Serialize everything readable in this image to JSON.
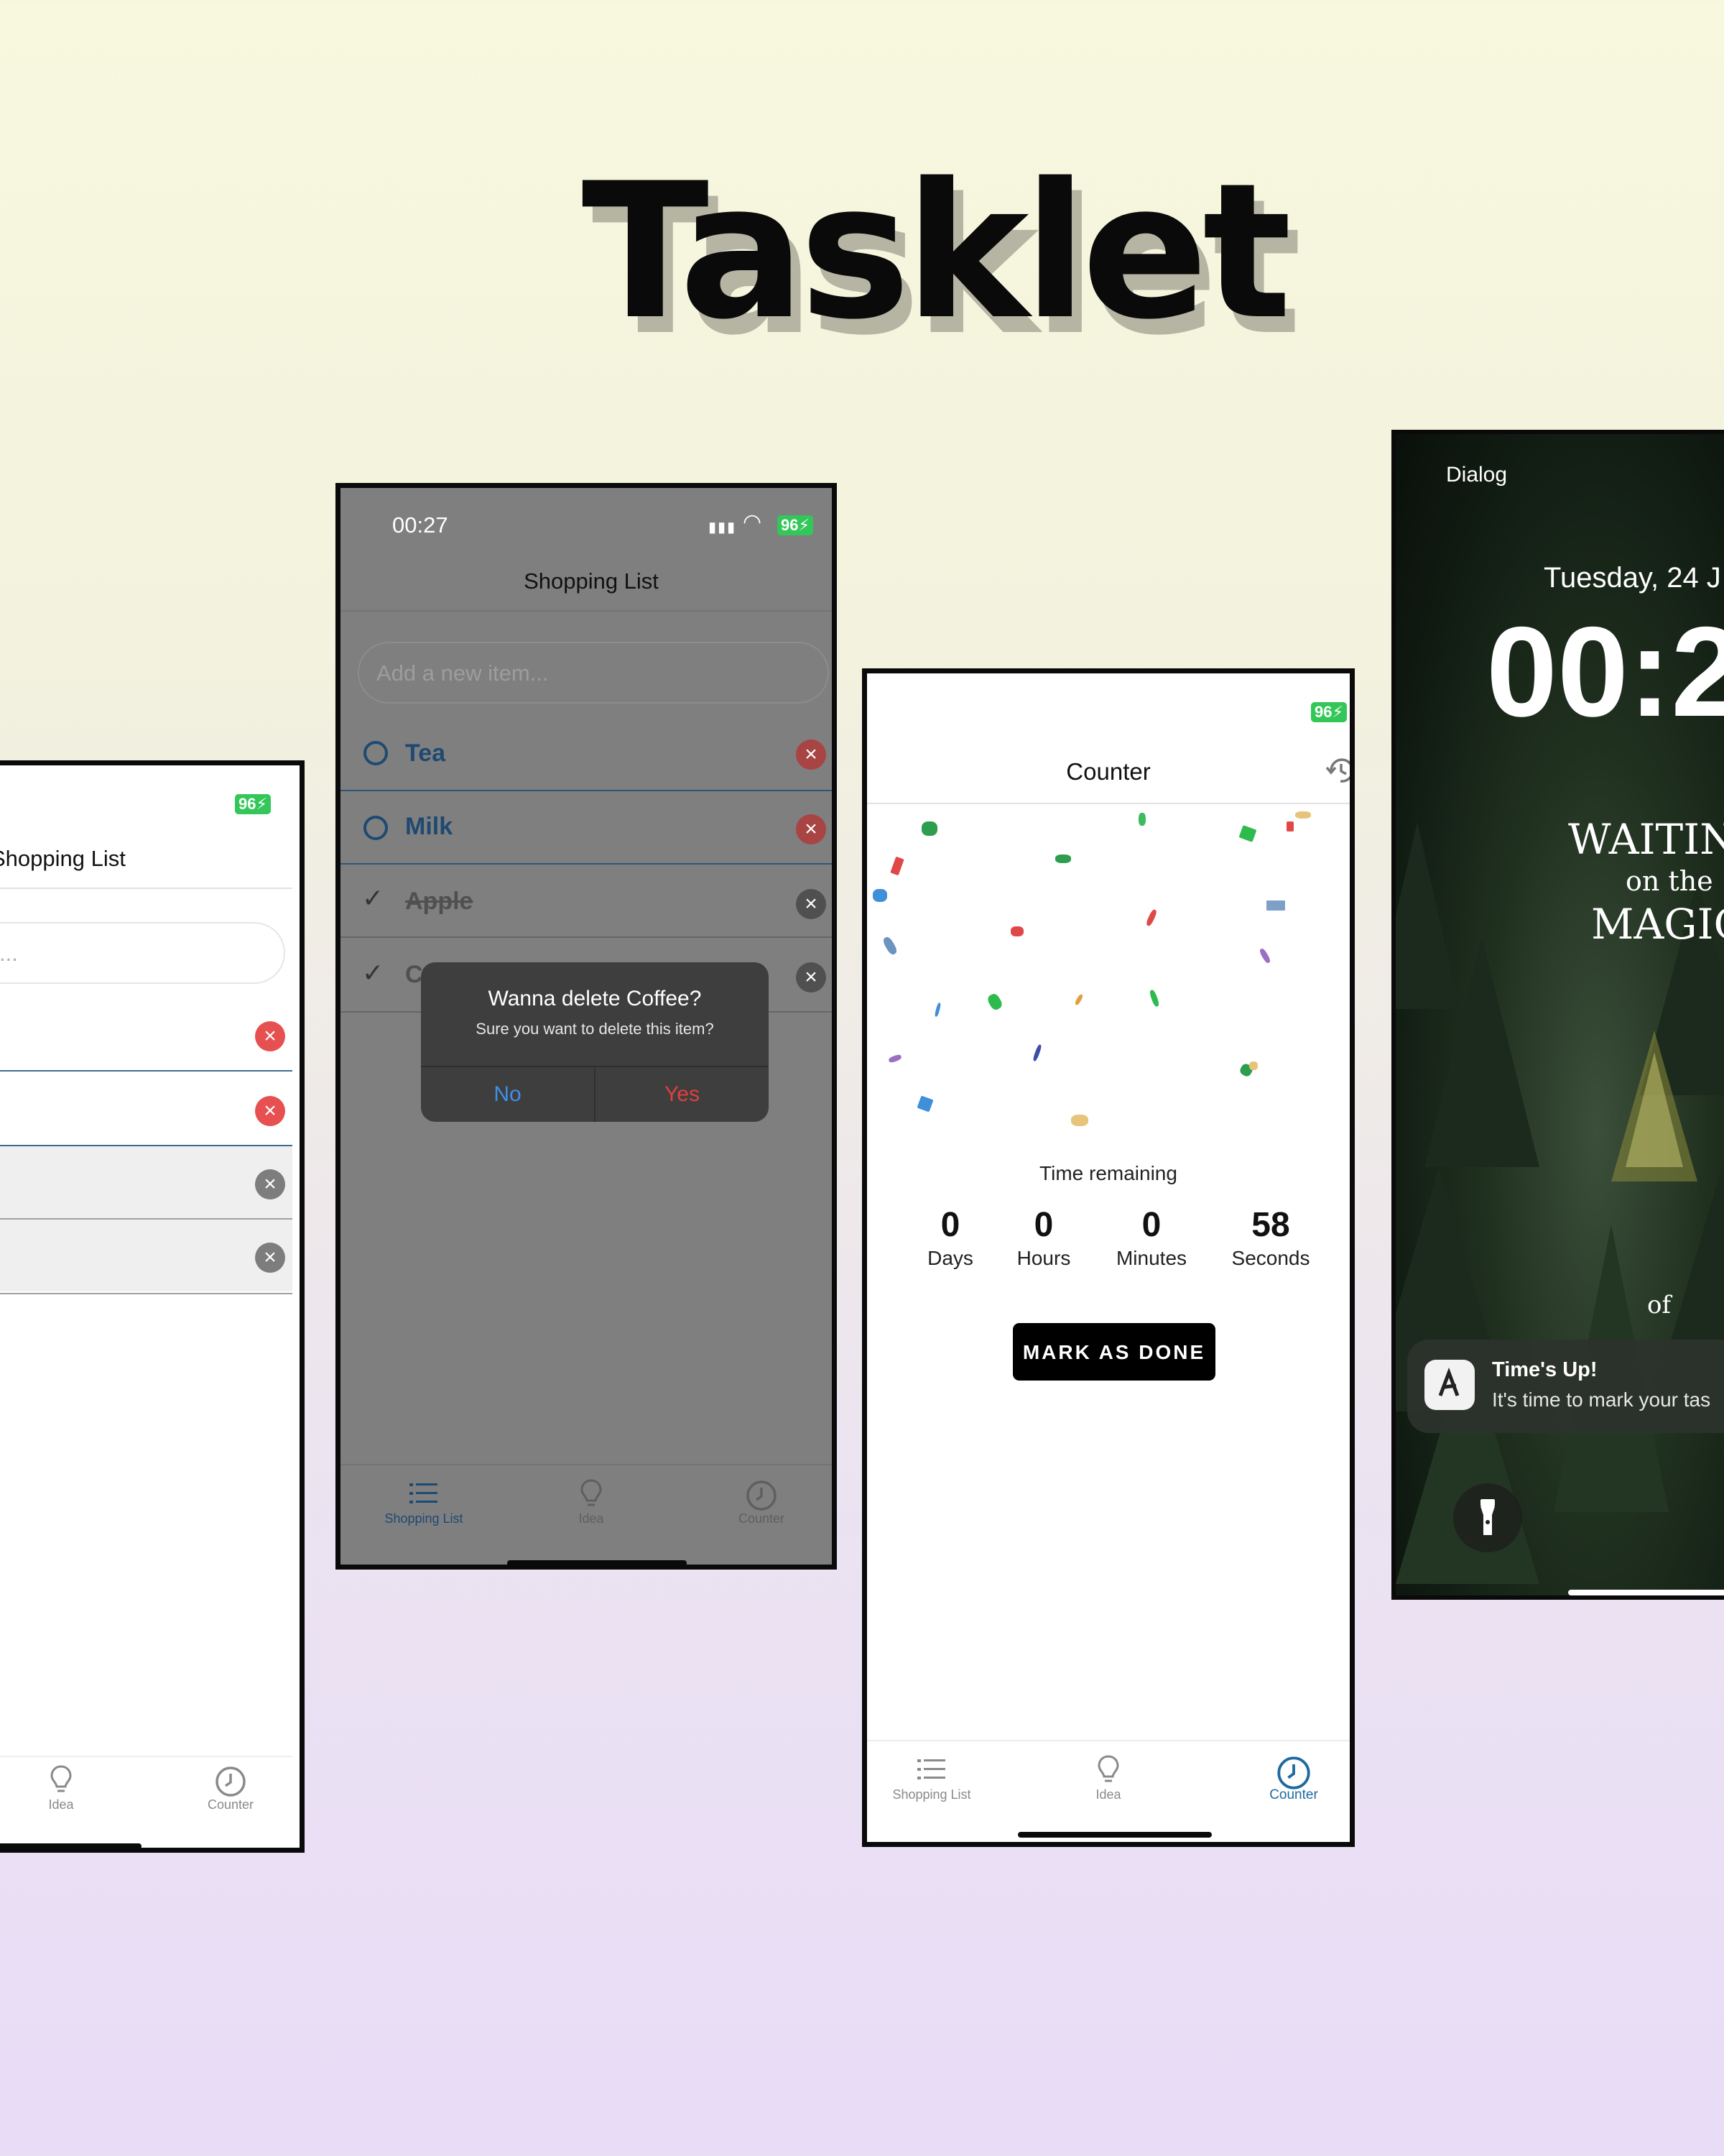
{
  "title": "Tasklet",
  "phone1": {
    "battery": "96",
    "header_title": "Shopping List",
    "input_placeholder_visible": "...",
    "tabs": [
      {
        "label": "Idea"
      },
      {
        "label": "Counter"
      }
    ]
  },
  "phone2": {
    "status_time": "00:27",
    "battery": "96",
    "header_title": "Shopping List",
    "input_placeholder": "Add a new item...",
    "items": [
      {
        "label": "Tea",
        "done": false
      },
      {
        "label": "Milk",
        "done": false
      },
      {
        "label": "Apple",
        "done": true
      },
      {
        "label": "C",
        "done": true
      }
    ],
    "dialog": {
      "title": "Wanna delete Coffee?",
      "message": "Sure you want to delete this item?",
      "no_label": "No",
      "yes_label": "Yes"
    },
    "tabs": [
      {
        "label": "Shopping List"
      },
      {
        "label": "Idea"
      },
      {
        "label": "Counter"
      }
    ]
  },
  "phone3": {
    "battery": "96",
    "header_title": "Counter",
    "time_remaining_label": "Time remaining",
    "countdown": [
      {
        "value": "0",
        "unit": "Days"
      },
      {
        "value": "0",
        "unit": "Hours"
      },
      {
        "value": "0",
        "unit": "Minutes"
      },
      {
        "value": "58",
        "unit": "Seconds"
      }
    ],
    "button_label": "MARK AS DONE",
    "tabs": [
      {
        "label": "Shopping List"
      },
      {
        "label": "Idea"
      },
      {
        "label": "Counter"
      }
    ],
    "active_tab": "Counter"
  },
  "phone4": {
    "top_label": "Dialog",
    "date": "Tuesday, 24 J",
    "time": "00:2",
    "wallpaper_lines": [
      "WAITIN",
      "on the",
      "MAGIC",
      "of"
    ],
    "notification": {
      "title": "Time's Up!",
      "body": "It's time to mark your tas"
    }
  },
  "colors": {
    "accent_blue": "#1e6aa0",
    "delete_red": "#e75050",
    "battery_green": "#33c759",
    "dialog_yes": "#e0403c",
    "dialog_no": "#3f8fe8"
  }
}
